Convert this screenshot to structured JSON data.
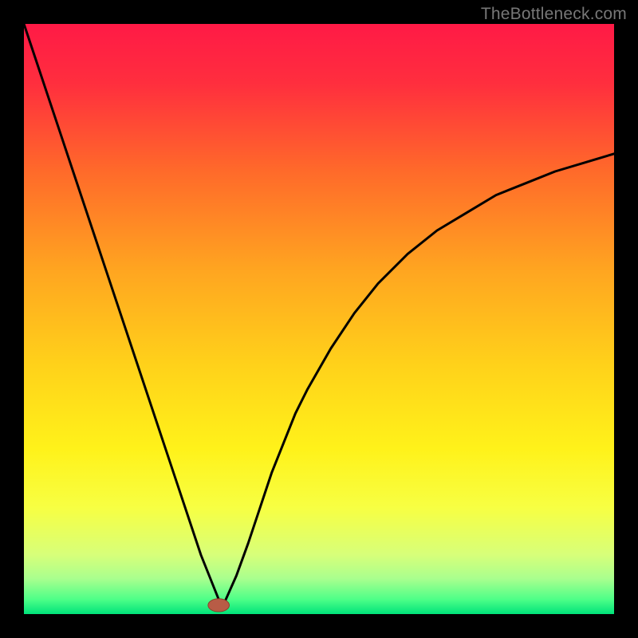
{
  "watermark": "TheBottleneck.com",
  "colors": {
    "frame": "#000000",
    "curve": "#000000",
    "marker_fill": "#b85c46",
    "marker_stroke": "#8e3f2d"
  },
  "chart_data": {
    "type": "line",
    "title": "",
    "xlabel": "",
    "ylabel": "",
    "xlim": [
      0,
      100
    ],
    "ylim": [
      0,
      100
    ],
    "grid": false,
    "legend": false,
    "background_gradient_stops": [
      {
        "offset": 0.0,
        "color": "#ff1a46"
      },
      {
        "offset": 0.1,
        "color": "#ff2e3e"
      },
      {
        "offset": 0.25,
        "color": "#ff6a2a"
      },
      {
        "offset": 0.42,
        "color": "#ffa620"
      },
      {
        "offset": 0.58,
        "color": "#ffd21a"
      },
      {
        "offset": 0.72,
        "color": "#fff21a"
      },
      {
        "offset": 0.82,
        "color": "#f7ff43"
      },
      {
        "offset": 0.9,
        "color": "#d7ff7a"
      },
      {
        "offset": 0.94,
        "color": "#a9ff8e"
      },
      {
        "offset": 0.975,
        "color": "#4eff88"
      },
      {
        "offset": 1.0,
        "color": "#00e37a"
      }
    ],
    "series": [
      {
        "name": "bottleneck-curve",
        "x": [
          0,
          2,
          4,
          6,
          8,
          10,
          12,
          14,
          16,
          18,
          20,
          22,
          24,
          26,
          28,
          30,
          32,
          33,
          34,
          36,
          38,
          40,
          42,
          44,
          46,
          48,
          52,
          56,
          60,
          65,
          70,
          75,
          80,
          85,
          90,
          95,
          100
        ],
        "y": [
          100,
          94,
          88,
          82,
          76,
          70,
          64,
          58,
          52,
          46,
          40,
          34,
          28,
          22,
          16,
          10,
          5,
          2.5,
          2,
          6.5,
          12,
          18,
          24,
          29,
          34,
          38,
          45,
          51,
          56,
          61,
          65,
          68,
          71,
          73,
          75,
          76.5,
          78
        ]
      }
    ],
    "marker": {
      "x": 33,
      "y": 1.5,
      "rx": 1.8,
      "ry": 1.1
    },
    "annotations": []
  }
}
